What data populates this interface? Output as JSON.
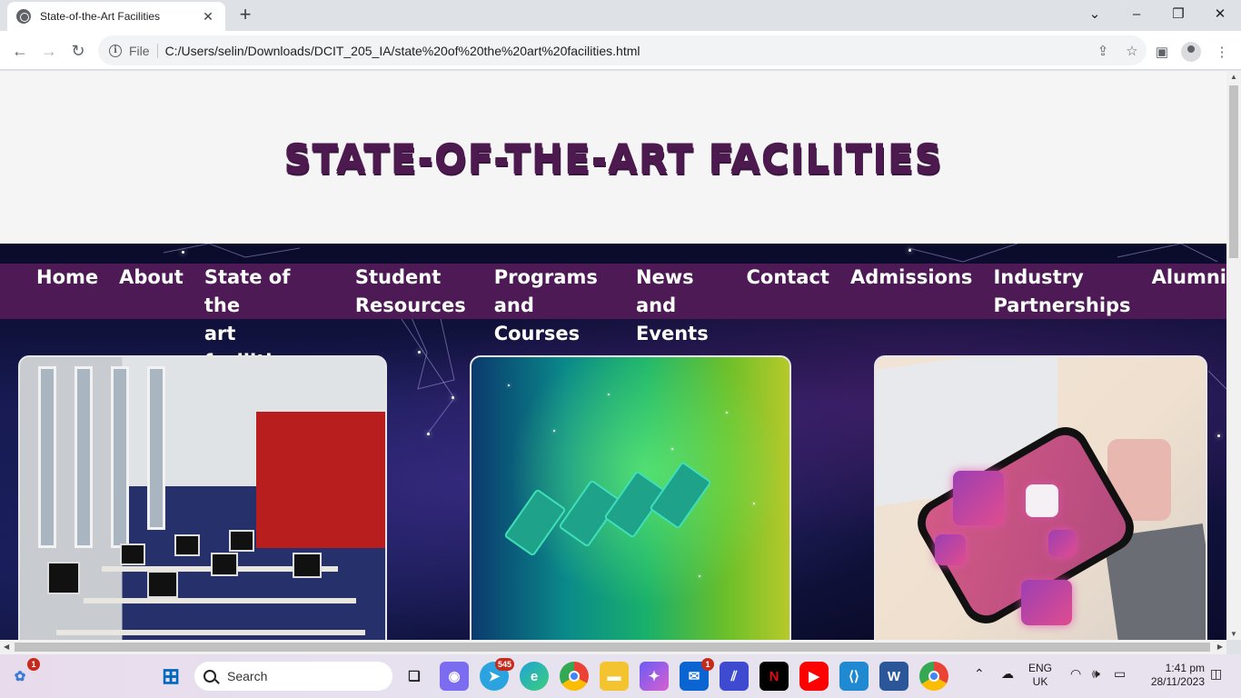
{
  "browser": {
    "tab_title": "State-of-the-Art Facilities",
    "scheme_label": "File",
    "url": "C:/Users/selin/Downloads/DCIT_205_IA/state%20of%20the%20art%20facilities.html"
  },
  "page": {
    "heading": "State-of-the-Art Facilities",
    "nav": [
      {
        "line1": "Home",
        "line2": ""
      },
      {
        "line1": "About",
        "line2": ""
      },
      {
        "line1": "State of the",
        "line2": "art facilities"
      },
      {
        "line1": "Student",
        "line2": "Resources"
      },
      {
        "line1": "Programs",
        "line2": "and Courses"
      },
      {
        "line1": "News and",
        "line2": "Events"
      },
      {
        "line1": "Contact",
        "line2": ""
      },
      {
        "line1": "Admissions",
        "line2": ""
      },
      {
        "line1": "Industry",
        "line2": "Partnerships"
      },
      {
        "line1": "Alumni",
        "line2": ""
      }
    ],
    "colors": {
      "brand": "#4d1a56",
      "heading": "#4d1a4f"
    }
  },
  "taskbar": {
    "search_placeholder": "Search",
    "widget_badge": "1",
    "telegram_badge": "545",
    "mail_badge": "1",
    "language_line1": "ENG",
    "language_line2": "UK",
    "time": "1:41 pm",
    "date": "28/11/2023"
  }
}
